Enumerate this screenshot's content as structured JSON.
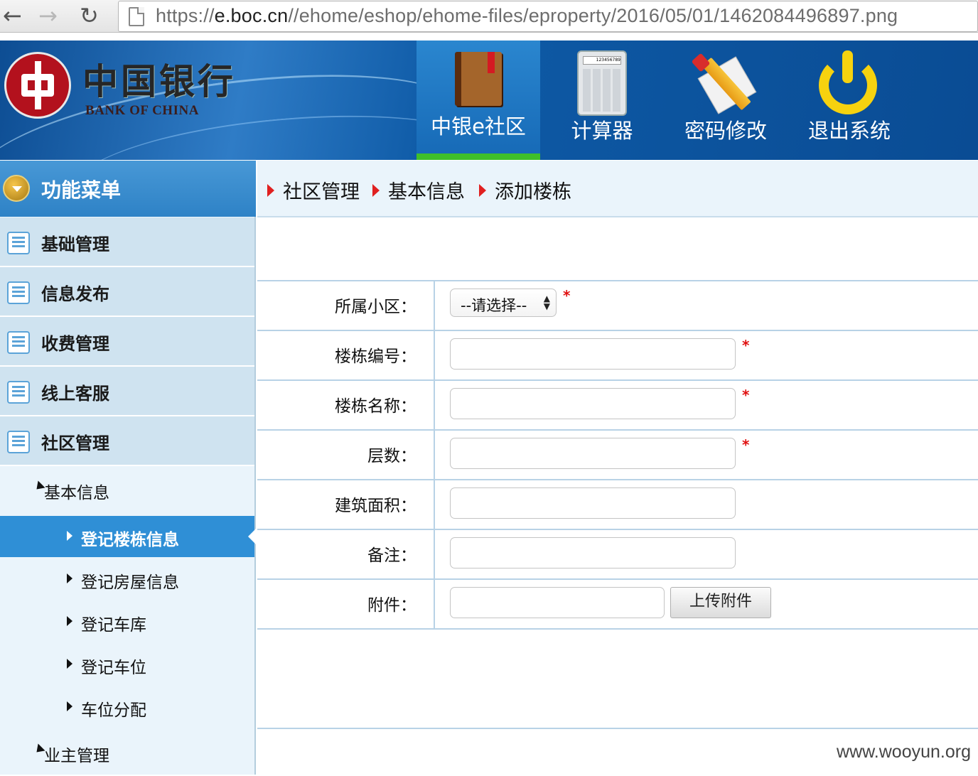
{
  "browser": {
    "url_prefix": "https://",
    "url_host": "e.boc.cn",
    "url_path": "//ehome/eshop/ehome-files/eproperty/2016/05/01/1462084496897.png"
  },
  "header": {
    "logo_cn": "中国银行",
    "logo_en": "BANK OF CHINA",
    "tools": [
      {
        "label": "中银e社区",
        "icon": "book-icon"
      },
      {
        "label": "计算器",
        "icon": "calculator-icon",
        "screen": "123456789"
      },
      {
        "label": "密码修改",
        "icon": "pencil-icon"
      },
      {
        "label": "退出系统",
        "icon": "power-icon"
      }
    ]
  },
  "sidebar": {
    "title": "功能菜单",
    "items": [
      {
        "label": "基础管理"
      },
      {
        "label": "信息发布"
      },
      {
        "label": "收费管理"
      },
      {
        "label": "线上客服"
      },
      {
        "label": "社区管理"
      }
    ],
    "group_basic": "基本信息",
    "leaves": [
      {
        "label": "登记楼栋信息",
        "active": true
      },
      {
        "label": "登记房屋信息"
      },
      {
        "label": "登记车库"
      },
      {
        "label": "登记车位"
      },
      {
        "label": "车位分配"
      }
    ],
    "group_owner": "业主管理"
  },
  "breadcrumb": [
    "社区管理",
    "基本信息",
    "添加楼栋"
  ],
  "form": {
    "community_label": "所属小区：",
    "community_value": "--请选择--",
    "building_no_label": "楼栋编号：",
    "building_name_label": "楼栋名称：",
    "floors_label": "层数：",
    "area_label": "建筑面积：",
    "remark_label": "备注：",
    "attachment_label": "附件：",
    "upload_button": "上传附件",
    "required_mark": "*"
  },
  "watermark": "www.wooyun.org",
  "colors": {
    "header_blue": "#0e5aa6",
    "active_blue": "#2f8fd6",
    "tab_green": "#3fbf2a",
    "required_red": "#e01010",
    "boc_red": "#b3111d"
  }
}
